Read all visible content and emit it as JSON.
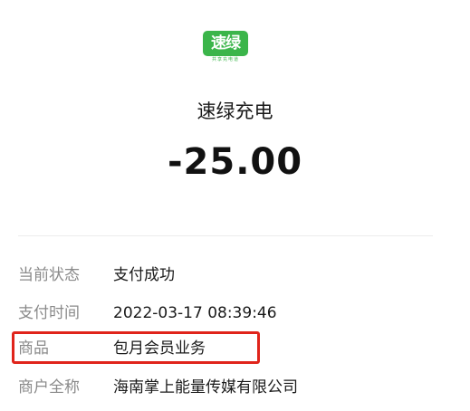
{
  "header": {
    "logo": {
      "text": "速绿",
      "slogan": "共享充电道",
      "color": "#3bb54a"
    },
    "merchant_name": "速绿充电",
    "amount": "-25.00"
  },
  "details": {
    "rows": [
      {
        "label": "当前状态",
        "value": "支付成功"
      },
      {
        "label": "支付时间",
        "value": "2022-03-17 08:39:46"
      },
      {
        "label": "商品",
        "value": "包月会员业务"
      },
      {
        "label": "商户全称",
        "value": "海南掌上能量传媒有限公司"
      }
    ]
  },
  "annotation": {
    "highlight_color": "#e0241b",
    "highlighted_row": "商品"
  }
}
